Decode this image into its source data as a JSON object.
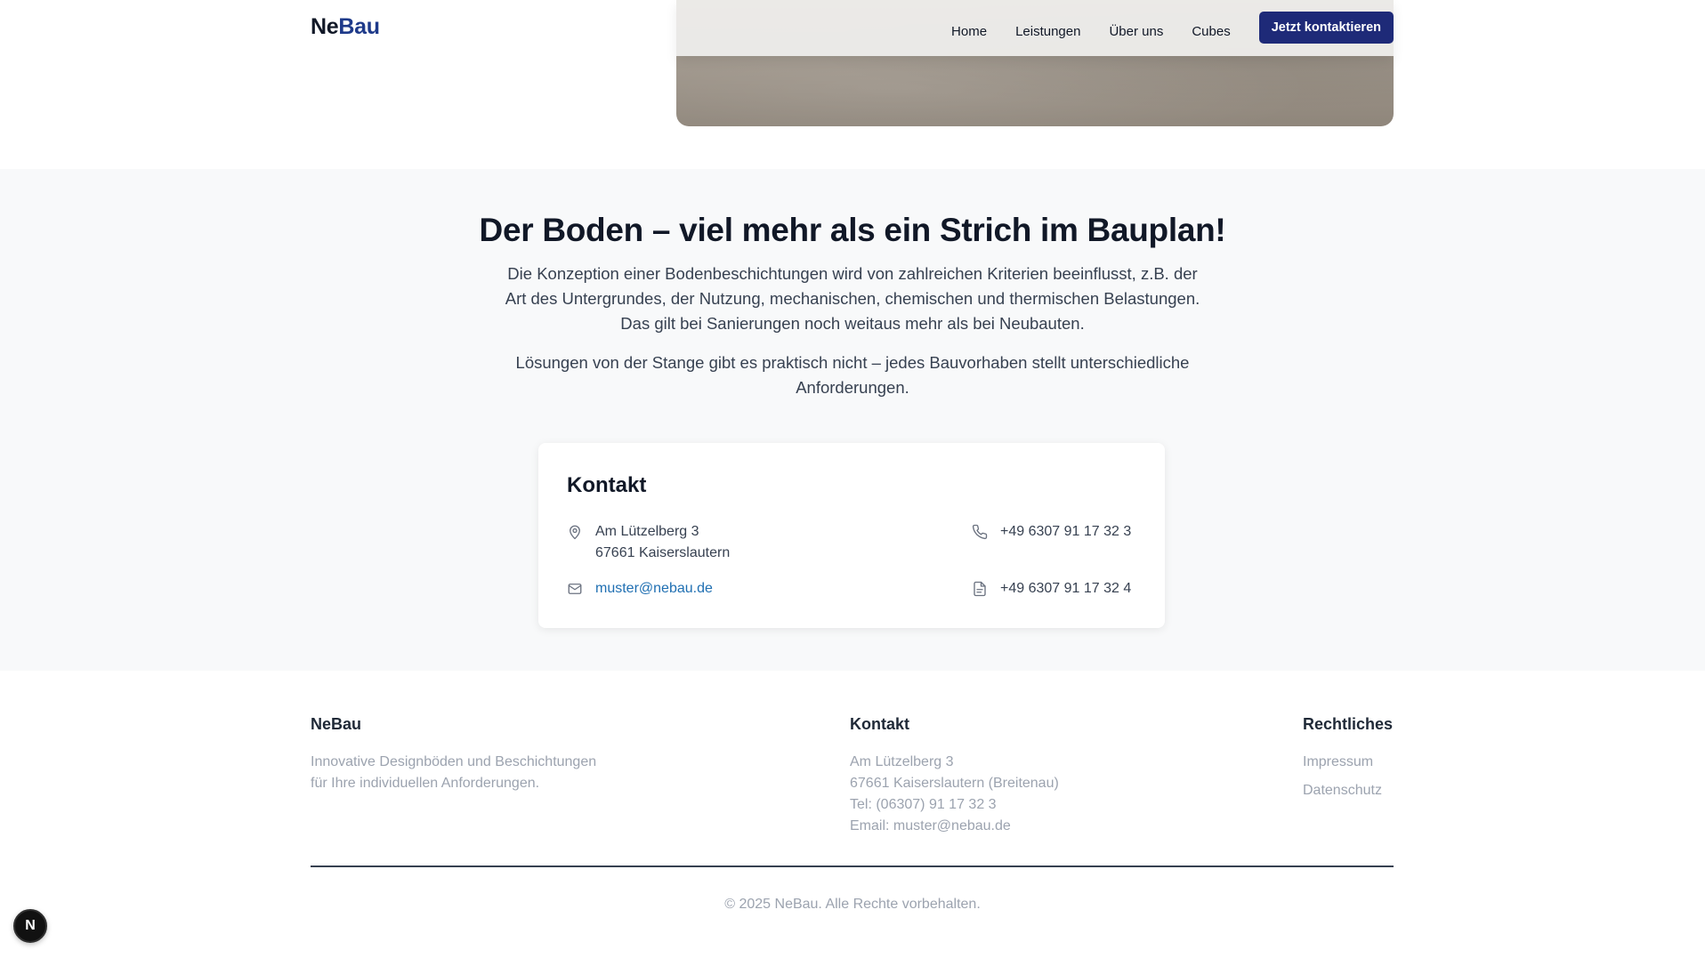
{
  "nav": {
    "logo_primary": "Ne",
    "logo_accent": "Bau",
    "links": [
      "Home",
      "Leistungen",
      "Über uns",
      "Cubes"
    ],
    "cta_label": "Jetzt kontaktieren"
  },
  "section": {
    "title": "Der Boden – viel mehr als ein Strich im Bauplan!",
    "paragraph_1": "Die Konzeption einer Bodenbeschichtungen wird von zahlreichen Kriterien beeinflusst, z.B. der Art des Untergrundes, der Nutzung, mechanischen, chemischen und thermischen Belastungen. Das gilt bei Sanierungen noch weitaus mehr als bei Neubauten.",
    "paragraph_2": "Lösungen von der Stange gibt es praktisch nicht – jedes Bauvorhaben stellt unterschiedliche Anforderungen."
  },
  "contact_card": {
    "title": "Kontakt",
    "address_line_1": "Am Lützelberg 3",
    "address_line_2": "67661 Kaiserslautern",
    "phone": "+49 6307 91 17 32 3",
    "email": "muster@nebau.de",
    "fax": "+49 6307 91 17 32 4",
    "icons": {
      "address": "map-pin-icon",
      "phone": "phone-icon",
      "email": "mail-icon",
      "fax": "document-icon"
    }
  },
  "footer": {
    "brand_heading": "NeBau",
    "brand_text_line_1": "Innovative Designböden und Beschichtungen",
    "brand_text_line_2": "für Ihre individuellen Anforderungen.",
    "contact_heading": "Kontakt",
    "contact_lines": [
      "Am Lützelberg 3",
      "67661 Kaiserslautern (Breitenau)",
      "Tel: (06307) 91 17 32 3",
      "Email: muster@nebau.de"
    ],
    "legal_heading": "Rechtliches",
    "legal_links": [
      "Impressum",
      "Datenschutz"
    ],
    "copyright": "© 2025 NeBau. Alle Rechte vorbehalten."
  },
  "dev_badge": {
    "letter": "N"
  },
  "colors": {
    "brand_navy": "#1e2a78",
    "logo_accent": "#1e3a8a",
    "link_blue": "#1f6fb2",
    "section_bg": "#f8f9fa"
  }
}
